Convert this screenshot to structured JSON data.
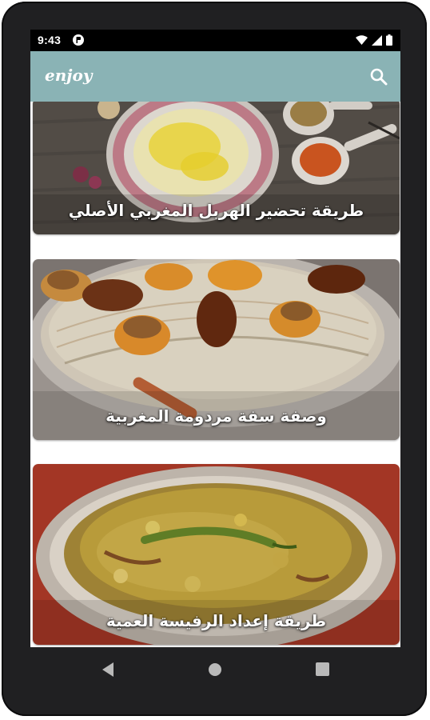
{
  "status_bar": {
    "time": "9:43"
  },
  "app_bar": {
    "title": "enjoy"
  },
  "recipes": [
    {
      "title": "طريقة تحضير الهربل المغربي الأصلي"
    },
    {
      "title": "وصفة سفة مردومة المغربية"
    },
    {
      "title": "طريقة إعداد الرفيسة العمية"
    }
  ],
  "colors": {
    "app_bar": "#8ab3b5",
    "frame": "#202022",
    "status_bar": "#000000"
  },
  "icons": [
    "app-notification-icon",
    "wifi-icon",
    "signal-icon",
    "battery-icon",
    "search-icon",
    "back-icon",
    "home-icon",
    "recents-icon"
  ]
}
